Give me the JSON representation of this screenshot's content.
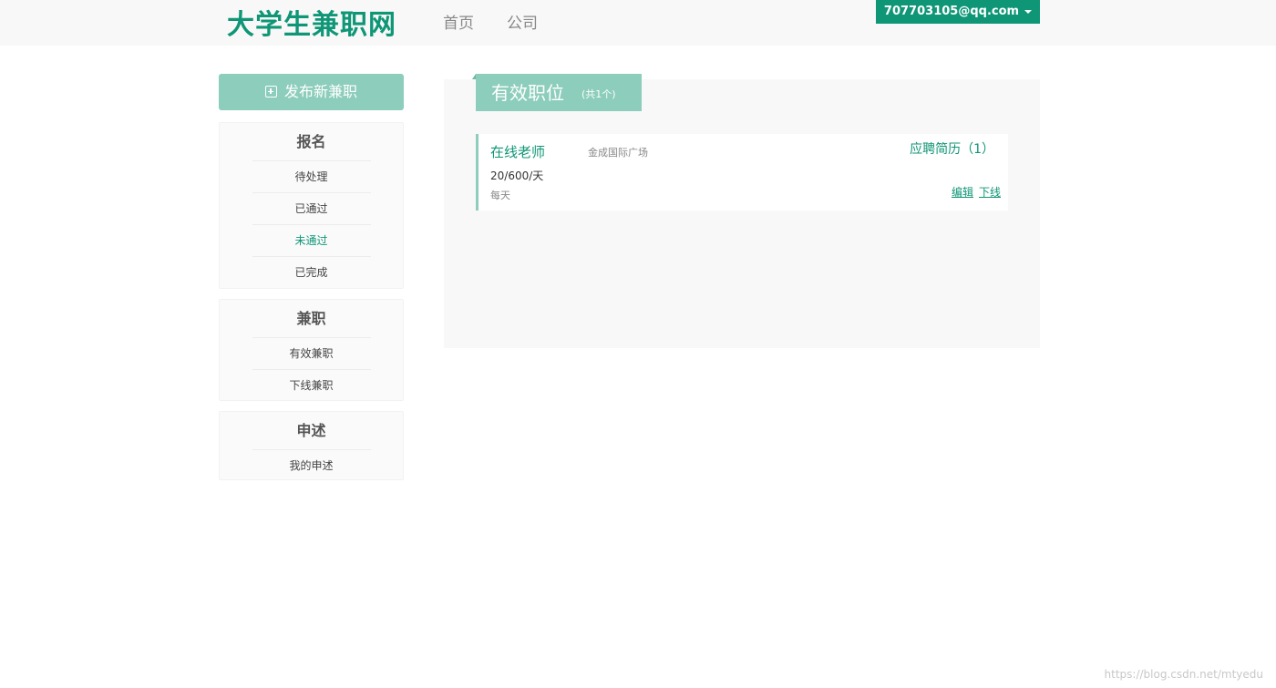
{
  "header": {
    "logo": "大学生兼职网",
    "nav": [
      {
        "label": "首页"
      },
      {
        "label": "公司"
      }
    ],
    "user_email": "707703105@qq.com"
  },
  "sidebar": {
    "publish_label": "发布新兼职",
    "groups": [
      {
        "title": "报名",
        "items": [
          {
            "label": "待处理"
          },
          {
            "label": "已通过"
          },
          {
            "label": "未通过",
            "active": true
          },
          {
            "label": "已完成"
          }
        ]
      },
      {
        "title": "兼职",
        "items": [
          {
            "label": "有效兼职"
          },
          {
            "label": "下线兼职"
          }
        ]
      },
      {
        "title": "申述",
        "items": [
          {
            "label": "我的申述"
          }
        ]
      }
    ]
  },
  "main": {
    "title": "有效职位",
    "count_text": "(共1个)",
    "jobs": [
      {
        "title": "在线老师",
        "location": "金成国际广场",
        "salary": "20/600/天",
        "frequency": "每天",
        "resume_link": "应聘简历（1）",
        "edit_label": "编辑",
        "offline_label": "下线"
      }
    ]
  },
  "watermark": "https://blog.csdn.net/mtyedu",
  "colors": {
    "brand": "#0f9676",
    "accent_light": "#8dcdbb",
    "panel_bg": "#f8f8f8"
  }
}
